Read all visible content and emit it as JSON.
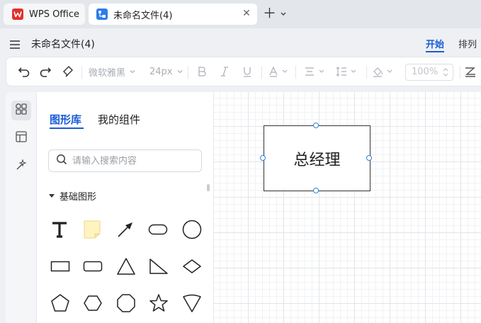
{
  "tabs": {
    "wps_label": "WPS Office",
    "doc_label": "未命名文件(4)"
  },
  "header": {
    "doc_title": "未命名文件(4)",
    "nav": [
      "开始",
      "排列"
    ]
  },
  "toolbar": {
    "font_family": "微软雅黑",
    "font_size": "24px",
    "zoom": "100%"
  },
  "panel": {
    "tab_library": "图形库",
    "tab_mine": "我的组件",
    "search_placeholder": "请输入搜索内容",
    "section_title": "基础图形"
  },
  "canvas": {
    "node_text": "总经理"
  },
  "colors": {
    "accent": "#1a5cd6",
    "wps_red": "#e0322b",
    "handle": "#2a86d9",
    "note_fill": "#fff3bf"
  },
  "icons": {
    "shapes": [
      "text",
      "note",
      "arrow",
      "rounded-rect",
      "circle",
      "rectangle",
      "rounded-rectangle",
      "triangle",
      "right-triangle",
      "diamond",
      "pentagon",
      "hexagon",
      "octagon",
      "star",
      "inverted-triangle"
    ]
  }
}
